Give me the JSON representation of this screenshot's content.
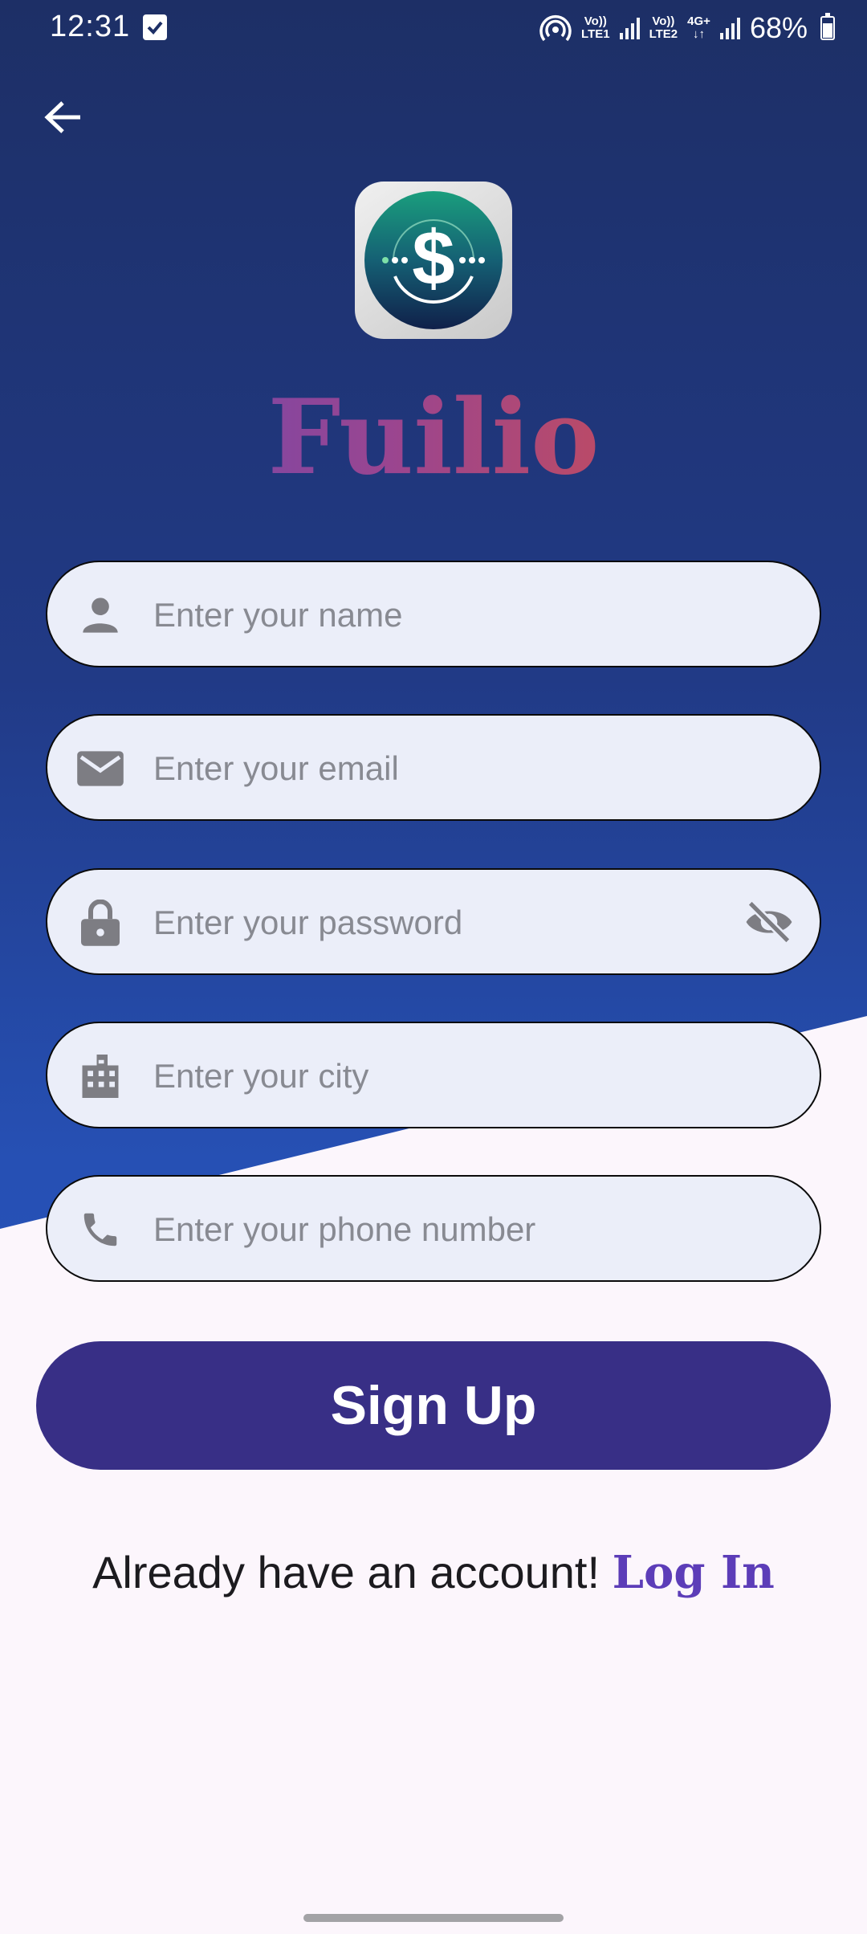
{
  "status_bar": {
    "time": "12:31",
    "net1_top": "Vo))",
    "net1_bottom": "LTE1",
    "net2_top": "Vo))",
    "net2_bottom": "LTE2",
    "net_type": "4G+",
    "battery": "68%"
  },
  "app": {
    "title": "Fuilio",
    "icon": "dollar-logo-icon"
  },
  "form": {
    "name_placeholder": "Enter your name",
    "email_placeholder": "Enter your email",
    "password_placeholder": "Enter your password",
    "city_placeholder": "Enter your city",
    "phone_placeholder": "Enter your phone number",
    "signup_label": "Sign Up"
  },
  "footer": {
    "prompt": "Already have an account!",
    "login_label": "Log In"
  },
  "colors": {
    "primary": "#382f86",
    "link": "#5c3db8",
    "field_bg": "#ebeef9",
    "header_bg": "#213a86"
  }
}
